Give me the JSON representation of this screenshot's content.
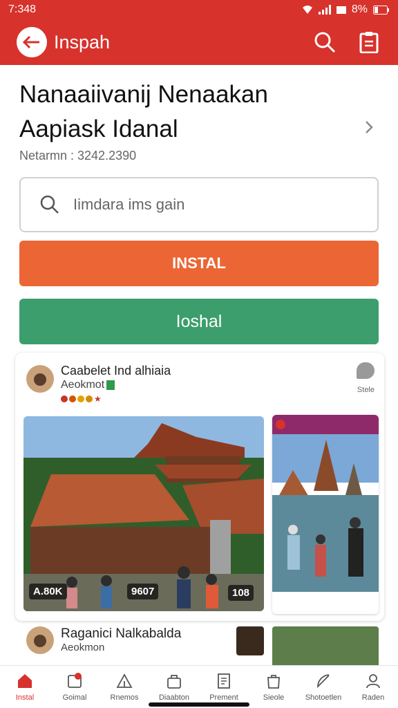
{
  "status": {
    "time": "7:348",
    "battery": "8%"
  },
  "app": {
    "title": "Inspah"
  },
  "page": {
    "title_line1": "Nanaaiivanij Nenaakan",
    "title_line2": "Aapiask Idanal",
    "version": "Netarmn : 3242.2390"
  },
  "search": {
    "placeholder": "Iimdara ims gain"
  },
  "buttons": {
    "install": "INSTAL",
    "secondary": "Ioshal"
  },
  "card": {
    "title": "Caabelet Ind alhiaia",
    "subtitle": "Aeokmot",
    "more_label": "Stele",
    "overlay_left": "A.80K",
    "overlay_mid": "9607",
    "overlay_right": "108"
  },
  "row2": {
    "title": "Raganici Nalkabalda",
    "subtitle": "Aeokmon"
  },
  "nav": {
    "items": [
      {
        "label": "Instal",
        "icon": "home-icon"
      },
      {
        "label": "Goimal",
        "icon": "notification-icon"
      },
      {
        "label": "Rnemos",
        "icon": "tent-icon"
      },
      {
        "label": "Diaabton",
        "icon": "bag-icon"
      },
      {
        "label": "Prement",
        "icon": "document-icon"
      },
      {
        "label": "Sieole",
        "icon": "shopping-bag-icon"
      },
      {
        "label": "Shotoetlen",
        "icon": "feather-icon"
      },
      {
        "label": "Raden",
        "icon": "profile-icon"
      }
    ]
  },
  "colors": {
    "brand": "#d7322c",
    "install": "#ec6534",
    "secondary": "#3c9e6c"
  }
}
